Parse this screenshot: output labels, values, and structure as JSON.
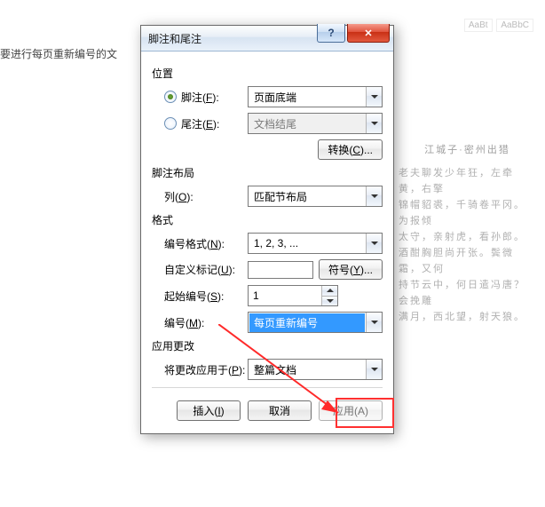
{
  "background": {
    "left_fragment": "要进行每页重新编号的文",
    "style_chips": [
      "AaBt",
      "AaBbC"
    ],
    "title": "江城子·密州出猎",
    "para_lines": [
      "老夫聊发少年狂，左牵黄，右擎",
      "锦帽貂裘，千骑卷平冈。为报倾",
      "太守，亲射虎，看孙郎。",
      "酒酣胸胆尚开张。鬓微霜，又何",
      "持节云中，何日遣冯唐？会挽雕",
      "满月，西北望，射天狼。"
    ]
  },
  "dialog": {
    "title": "脚注和尾注",
    "sections": {
      "position": "位置",
      "layout": "脚注布局",
      "format": "格式",
      "apply": "应用更改"
    },
    "footnote_label": "脚注(F):",
    "endnote_label": "尾注(E):",
    "footnote_value": "页面底端",
    "endnote_value": "文档结尾",
    "convert_button": "转换(C)...",
    "columns_label": "列(O):",
    "columns_value": "匹配节布局",
    "num_format_label": "编号格式(N):",
    "num_format_value": "1, 2, 3, ...",
    "custom_mark_label": "自定义标记(U):",
    "custom_mark_value": "",
    "symbol_button": "符号(Y)...",
    "start_at_label": "起始编号(S):",
    "start_at_value": "1",
    "numbering_label": "编号(M):",
    "numbering_value": "每页重新编号",
    "apply_to_label": "将更改应用于(P):",
    "apply_to_value": "整篇文档",
    "insert_button": "插入(I)",
    "cancel_button": "取消",
    "apply_button": "应用(A)"
  }
}
